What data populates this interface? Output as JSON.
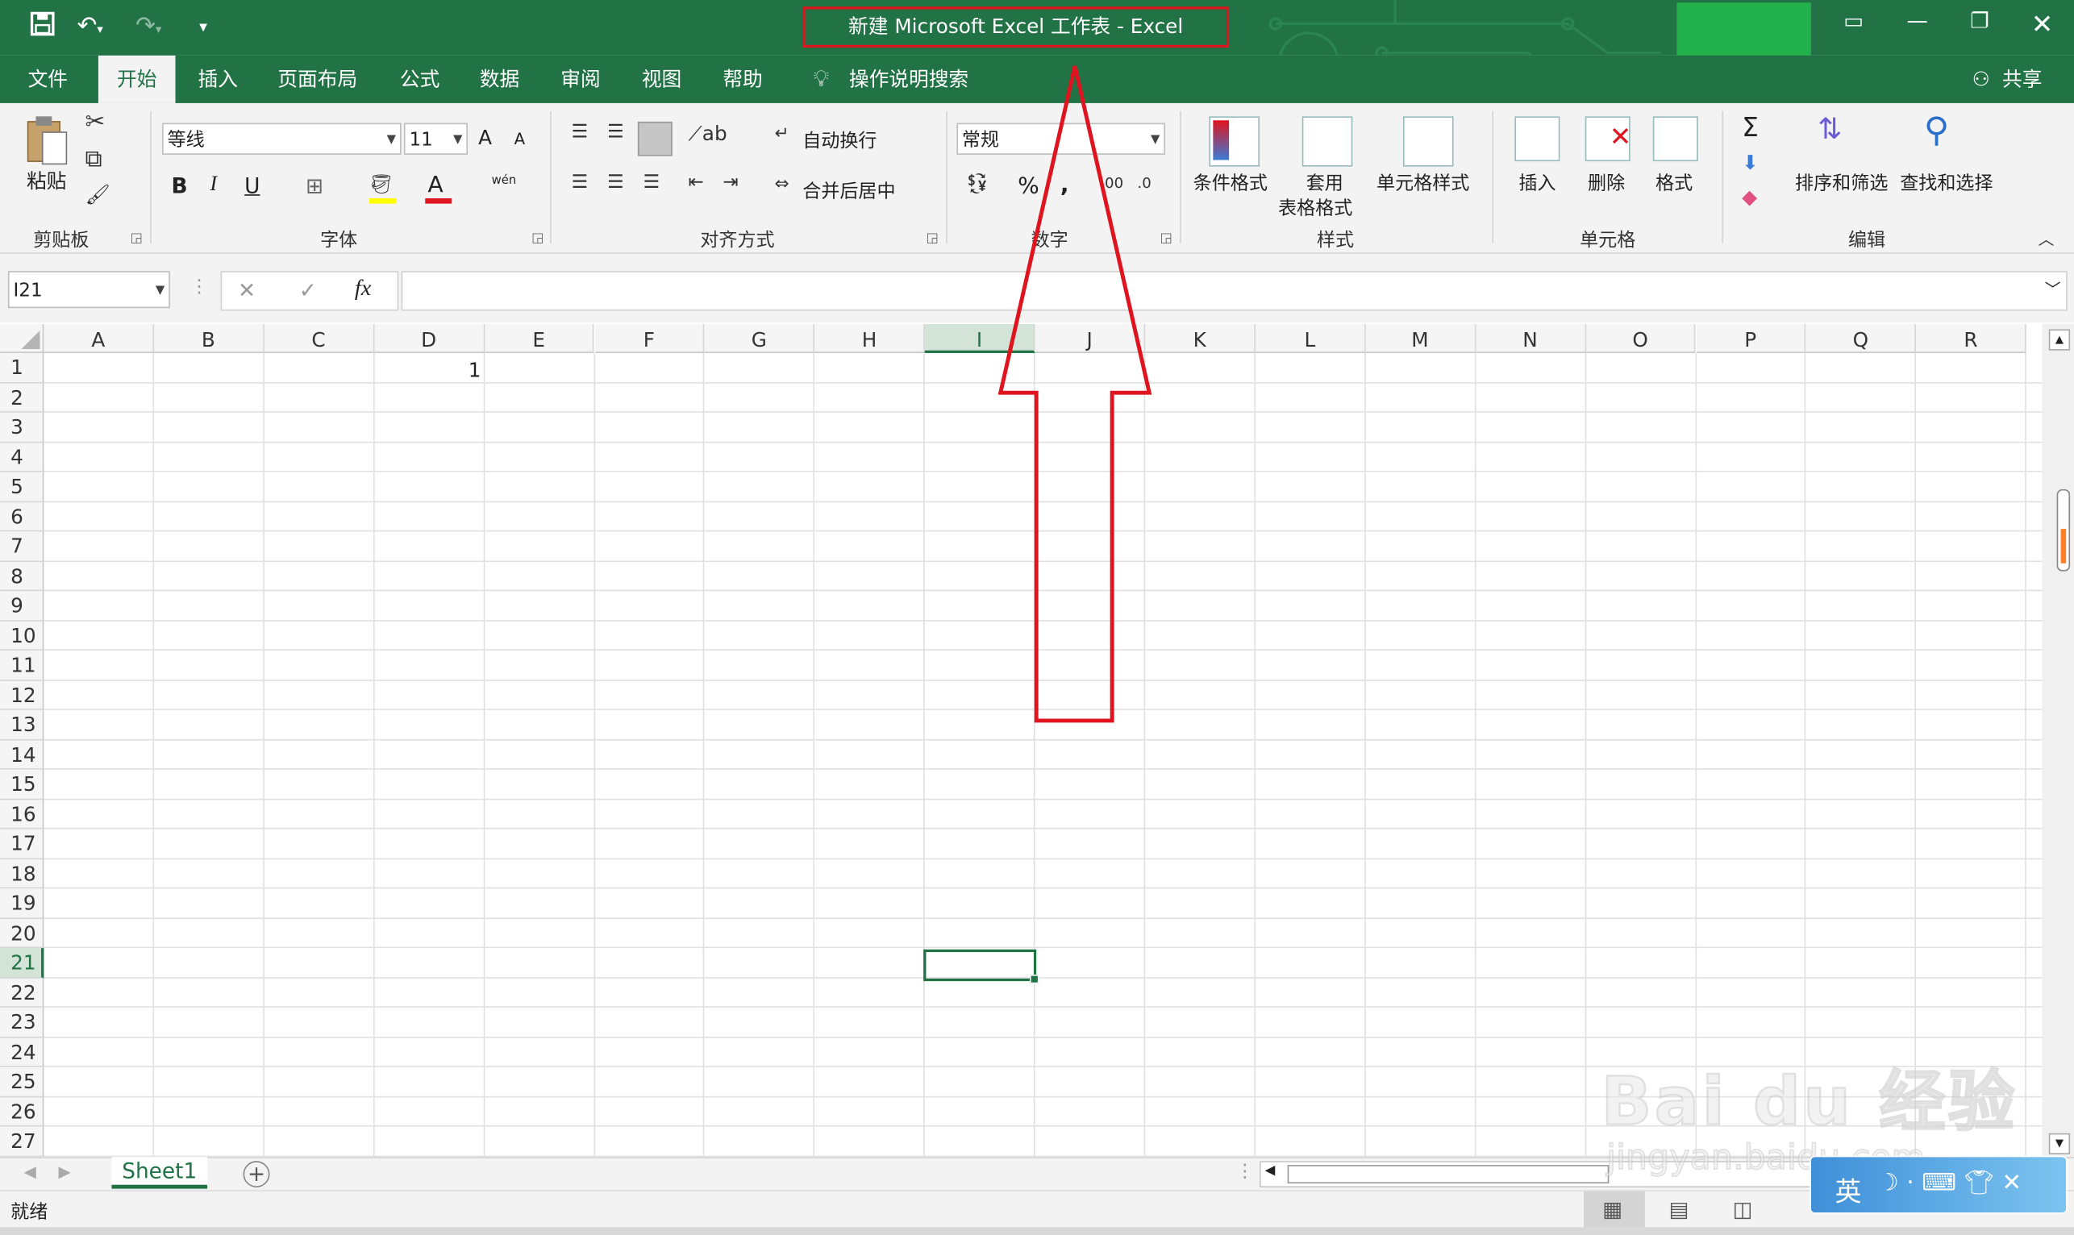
{
  "window": {
    "title": "新建 Microsoft Excel 工作表  -  Excel",
    "share_label": "共享"
  },
  "tabs": [
    {
      "label": "文件",
      "active": false
    },
    {
      "label": "开始",
      "active": true
    },
    {
      "label": "插入",
      "active": false
    },
    {
      "label": "页面布局",
      "active": false
    },
    {
      "label": "公式",
      "active": false
    },
    {
      "label": "数据",
      "active": false
    },
    {
      "label": "审阅",
      "active": false
    },
    {
      "label": "视图",
      "active": false
    },
    {
      "label": "帮助",
      "active": false
    }
  ],
  "search_label": "操作说明搜索",
  "ribbon": {
    "clipboard": {
      "paste": "粘贴",
      "group": "剪贴板"
    },
    "font": {
      "name": "等线",
      "size": "11",
      "group": "字体",
      "bold": "B",
      "italic": "I",
      "underline": "U",
      "grow": "A",
      "shrink": "A",
      "color_a": "A",
      "phonetic": "wén"
    },
    "alignment": {
      "wrap": "自动换行",
      "merge": "合并后居中",
      "group": "对齐方式"
    },
    "number": {
      "format": "常规",
      "group": "数字",
      "percent": "%",
      "comma": ","
    },
    "styles": {
      "conditional": "条件格式",
      "table_line1": "套用",
      "table_line2": "表格格式",
      "cell_styles": "单元格样式",
      "group": "样式"
    },
    "cells": {
      "insert": "插入",
      "delete": "删除",
      "format": "格式",
      "group": "单元格"
    },
    "editing": {
      "sort": "排序和筛选",
      "find": "查找和选择",
      "group": "编辑",
      "sum": "Σ"
    }
  },
  "formula_bar": {
    "name_box": "I21",
    "fx": "fx",
    "formula": ""
  },
  "sheet": {
    "columns": [
      "A",
      "B",
      "C",
      "D",
      "E",
      "F",
      "G",
      "H",
      "I",
      "J",
      "K",
      "L",
      "M",
      "N",
      "O",
      "P",
      "Q",
      "R"
    ],
    "rows": [
      "1",
      "2",
      "3",
      "4",
      "5",
      "6",
      "7",
      "8",
      "9",
      "10",
      "11",
      "12",
      "13",
      "14",
      "15",
      "16",
      "17",
      "18",
      "19",
      "20",
      "21",
      "22",
      "23",
      "24",
      "25",
      "26",
      "27"
    ],
    "selected_column": "I",
    "selected_row": "21",
    "cell_d1": "1"
  },
  "sheet_tabs": [
    "Sheet1"
  ],
  "status": {
    "ready": "就绪"
  },
  "watermark": {
    "logo": "Bai du 经验",
    "url": "jingyan.baidu.com"
  },
  "ime": {
    "label": "英"
  },
  "colors": {
    "excel_green": "#217346",
    "annotation_red": "#e0141e",
    "placeholder_green": "#22b14c"
  }
}
